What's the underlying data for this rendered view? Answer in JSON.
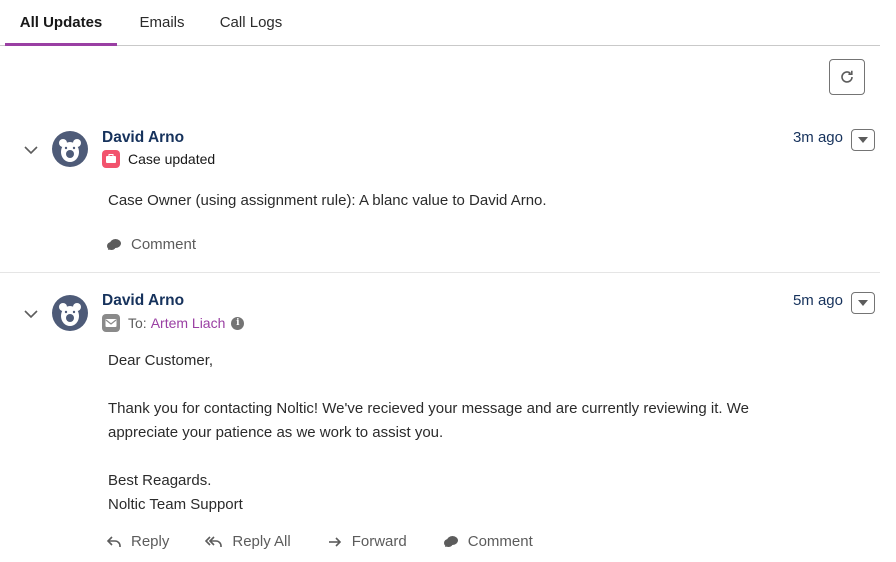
{
  "tabs": [
    {
      "label": "All Updates",
      "active": true
    },
    {
      "label": "Emails",
      "active": false
    },
    {
      "label": "Call Logs",
      "active": false
    }
  ],
  "refresh": {
    "icon": "refresh-icon"
  },
  "feed": [
    {
      "author": "David Arno",
      "time": "3m ago",
      "type_label": "Case updated",
      "type_icon": "case-icon",
      "body": "Case Owner (using assignment rule): A blanc value to David Arno.",
      "actions": [
        {
          "label": "Comment",
          "icon": "comment-icon"
        }
      ]
    },
    {
      "author": "David Arno",
      "time": "5m ago",
      "to_label": "To:",
      "to_name": "Artem Liach",
      "type_icon": "email-icon",
      "greeting": "Dear Customer,",
      "paragraph_line1": "Thank you for contacting Noltic! We've recieved your message and are currently reviewing it. We",
      "paragraph_line2": "appreciate your patience as we work to assist you.",
      "closing": "Best Reagards.",
      "signature": "Noltic Team Support",
      "actions": [
        {
          "label": "Reply",
          "icon": "reply-icon"
        },
        {
          "label": "Reply All",
          "icon": "reply-all-icon"
        },
        {
          "label": "Forward",
          "icon": "forward-icon"
        },
        {
          "label": "Comment",
          "icon": "comment-icon"
        }
      ]
    }
  ],
  "colors": {
    "accent": "#9a3fa3",
    "author": "#16325c",
    "case": "#f2536d",
    "avatar": "#4e5b78"
  }
}
